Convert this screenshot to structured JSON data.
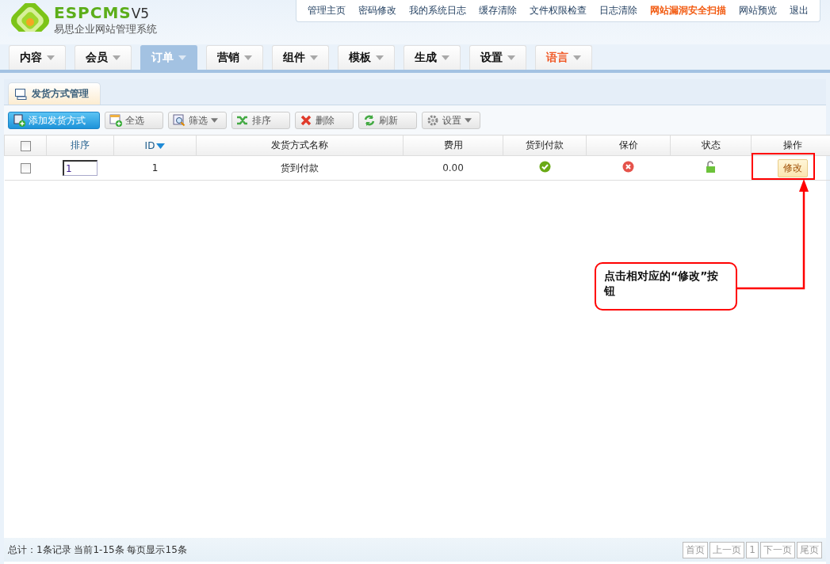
{
  "logo": {
    "brand": "ESPCMS",
    "version": "V5",
    "subtitle": "易思企业网站管理系统"
  },
  "top_links": [
    {
      "label": "管理主页",
      "kind": "normal"
    },
    {
      "label": "密码修改",
      "kind": "normal"
    },
    {
      "label": "我的系统日志",
      "kind": "normal"
    },
    {
      "label": "缓存清除",
      "kind": "normal"
    },
    {
      "label": "文件权限检查",
      "kind": "normal"
    },
    {
      "label": "日志清除",
      "kind": "normal"
    },
    {
      "label": "网站漏洞安全扫描",
      "kind": "alert"
    },
    {
      "label": "网站预览",
      "kind": "normal"
    },
    {
      "label": "退出",
      "kind": "normal"
    }
  ],
  "nav_tabs": [
    {
      "label": "内容",
      "selected": false,
      "kind": "normal"
    },
    {
      "label": "会员",
      "selected": false,
      "kind": "normal"
    },
    {
      "label": "订单",
      "selected": true,
      "kind": "normal"
    },
    {
      "label": "营销",
      "selected": false,
      "kind": "normal"
    },
    {
      "label": "组件",
      "selected": false,
      "kind": "normal"
    },
    {
      "label": "模板",
      "selected": false,
      "kind": "normal"
    },
    {
      "label": "生成",
      "selected": false,
      "kind": "normal"
    },
    {
      "label": "设置",
      "selected": false,
      "kind": "normal"
    },
    {
      "label": "语言",
      "selected": false,
      "kind": "accent"
    }
  ],
  "page_tab": "发货方式管理",
  "toolbar": [
    {
      "label": "添加发货方式",
      "kind": "add",
      "primary": true,
      "dropdown": false
    },
    {
      "label": "全选",
      "kind": "select",
      "primary": false,
      "dropdown": false
    },
    {
      "label": "筛选",
      "kind": "filter",
      "primary": false,
      "dropdown": true
    },
    {
      "label": "排序",
      "kind": "sort",
      "primary": false,
      "dropdown": false
    },
    {
      "label": "删除",
      "kind": "delete",
      "primary": false,
      "dropdown": false
    },
    {
      "label": "刷新",
      "kind": "refresh",
      "primary": false,
      "dropdown": false
    },
    {
      "label": "设置",
      "kind": "gear",
      "primary": false,
      "dropdown": true
    }
  ],
  "table": {
    "header_checked": false,
    "columns": [
      {
        "label": "排序",
        "sorted": false,
        "link": true
      },
      {
        "label": "ID",
        "sorted": true,
        "link": true
      },
      {
        "label": "发货方式名称",
        "sorted": false,
        "link": false
      },
      {
        "label": "费用",
        "sorted": false,
        "link": false
      },
      {
        "label": "货到付款",
        "sorted": false,
        "link": false
      },
      {
        "label": "保价",
        "sorted": false,
        "link": false
      },
      {
        "label": "状态",
        "sorted": false,
        "link": false
      },
      {
        "label": "操作",
        "sorted": false,
        "link": false
      }
    ],
    "rows": [
      {
        "checked": false,
        "order": "1",
        "id": "1",
        "name": "货到付款",
        "fee": "0.00",
        "cod": true,
        "insured": false,
        "unlocked": true,
        "action": "修改"
      }
    ]
  },
  "callout": "点击相对应的“修改”按钮",
  "footer": {
    "summary": "总计：1条记录 当前1-15条 每页显示15条",
    "pager": [
      {
        "label": "首页"
      },
      {
        "label": "上一页"
      },
      {
        "label": "1"
      },
      {
        "label": "下一页"
      },
      {
        "label": "尾页"
      }
    ]
  }
}
